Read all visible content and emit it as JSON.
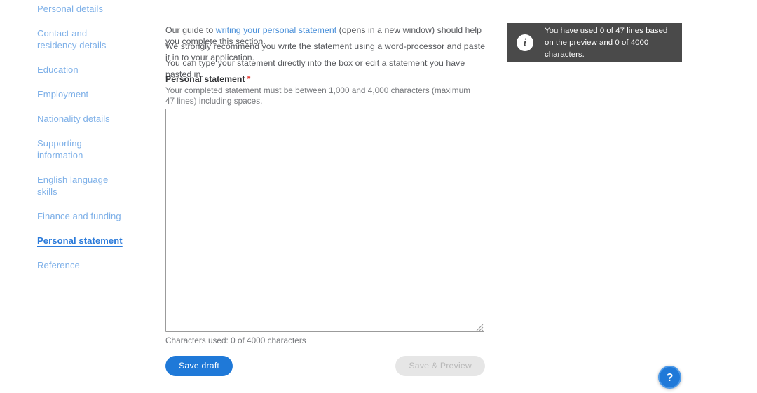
{
  "sidebar": {
    "items": [
      {
        "label": "Personal details",
        "active": false
      },
      {
        "label": "Contact and residency details",
        "active": false
      },
      {
        "label": "Education",
        "active": false
      },
      {
        "label": "Employment",
        "active": false
      },
      {
        "label": "Nationality details",
        "active": false
      },
      {
        "label": "Supporting information",
        "active": false
      },
      {
        "label": "English language skills",
        "active": false
      },
      {
        "label": "Finance and funding",
        "active": false
      },
      {
        "label": "Personal statement",
        "active": true
      },
      {
        "label": "Reference",
        "active": false
      }
    ]
  },
  "main": {
    "paragraph1_prefix": "Our guide to ",
    "paragraph1_link": "writing your personal statement",
    "paragraph1_suffix": " (opens in a new window) should help you complete this section.",
    "paragraph2": "We strongly recommend you write the statement using a word-processor and paste it in to your application.",
    "paragraph3": "You can type your statement directly into the box or edit a statement you have pasted in.",
    "field_label": "Personal statement",
    "required_marker": "*",
    "field_help": "Your completed statement must be between 1,000 and 4,000 characters (maximum 47 lines) including spaces.",
    "textarea_value": "",
    "textarea_placeholder": "",
    "character_count": "Characters used: 0 of 4000 characters"
  },
  "buttons": {
    "save_draft": "Save draft",
    "save_preview": "Save & Preview"
  },
  "info_box": {
    "icon": "info-icon",
    "message": "You have used 0 of 47 lines based on the preview and 0 of 4000 characters."
  },
  "help": {
    "label": "?"
  },
  "colors": {
    "accent_blue": "#1f79d8",
    "link_blue": "#4a90d9",
    "nav_blue": "#7eb0e8",
    "nav_active_blue": "#2a7ada",
    "required_red": "#e8403a",
    "info_bg": "#4a4a4a",
    "disabled_bg": "#e6e6e6",
    "disabled_text": "#b9b9b9"
  }
}
